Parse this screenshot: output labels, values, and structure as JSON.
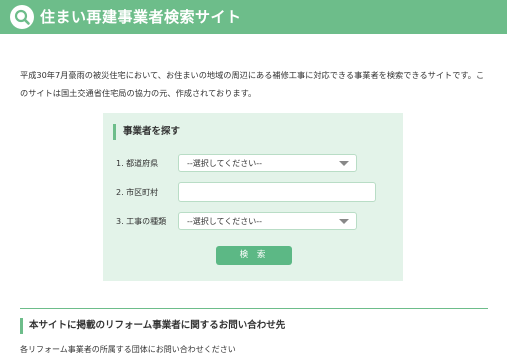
{
  "header": {
    "site_title": "住まい再建事業者検索サイト",
    "logo_icon": "magnifier-icon",
    "background_color": "#6dbd8a"
  },
  "intro": {
    "text": "平成30年7月豪雨の被災住宅において、お住まいの地域の周辺にある補修工事に対応できる事業者を検索できるサイトです。このサイトは国土交通省住宅局の協力の元、作成されております。"
  },
  "search_panel": {
    "title": "事業者を探す",
    "fields": [
      {
        "label": "1. 都道府県",
        "type": "select",
        "value": "--選択してください--"
      },
      {
        "label": "2. 市区町村",
        "type": "text",
        "value": ""
      },
      {
        "label": "3. 工事の種類",
        "type": "select",
        "value": "--選択してください--"
      }
    ],
    "search_button_label": "検 索",
    "background_color": "#e3f3e9",
    "accent_color": "#5cb885"
  },
  "contact_section": {
    "title": "本サイトに掲載のリフォーム事業者に関するお問い合わせ先",
    "note": "各リフォーム事業者の所属する団体にお問い合わせください"
  }
}
